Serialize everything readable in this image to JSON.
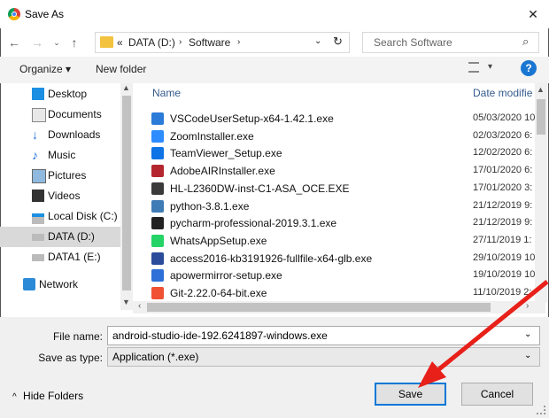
{
  "window": {
    "title": "Save As"
  },
  "nav": {
    "path": [
      "DATA (D:)",
      "Software"
    ],
    "overflow": "«",
    "search_placeholder": "Search Software"
  },
  "toolbar": {
    "organize": "Organize ▾",
    "new_folder": "New folder"
  },
  "sidebar": {
    "items": [
      {
        "label": "Desktop"
      },
      {
        "label": "Documents"
      },
      {
        "label": "Downloads"
      },
      {
        "label": "Music"
      },
      {
        "label": "Pictures"
      },
      {
        "label": "Videos"
      },
      {
        "label": "Local Disk (C:)"
      },
      {
        "label": "DATA (D:)"
      },
      {
        "label": "DATA1 (E:)"
      },
      {
        "label": "Network"
      }
    ]
  },
  "list": {
    "col_name": "Name",
    "col_date": "Date modified",
    "files": [
      {
        "name": "VSCodeUserSetup-x64-1.42.1.exe",
        "date": "05/03/2020 10",
        "color": "#2b7bd9"
      },
      {
        "name": "ZoomInstaller.exe",
        "date": "02/03/2020 6:",
        "color": "#2d8cff"
      },
      {
        "name": "TeamViewer_Setup.exe",
        "date": "12/02/2020 6:",
        "color": "#0e73e4"
      },
      {
        "name": "AdobeAIRInstaller.exe",
        "date": "17/01/2020 6:",
        "color": "#b4262e"
      },
      {
        "name": "HL-L2360DW-inst-C1-ASA_OCE.EXE",
        "date": "17/01/2020 3:",
        "color": "#3a3a3a"
      },
      {
        "name": "python-3.8.1.exe",
        "date": "21/12/2019 9:",
        "color": "#3f7cb5"
      },
      {
        "name": "pycharm-professional-2019.3.1.exe",
        "date": "21/12/2019 9:",
        "color": "#222222"
      },
      {
        "name": "WhatsAppSetup.exe",
        "date": "27/11/2019 1:",
        "color": "#25d366"
      },
      {
        "name": "access2016-kb3191926-fullfile-x64-glb.exe",
        "date": "29/10/2019 10",
        "color": "#2b4c9a"
      },
      {
        "name": "apowermirror-setup.exe",
        "date": "19/10/2019 10",
        "color": "#2e6fd8"
      },
      {
        "name": "Git-2.22.0-64-bit.exe",
        "date": "11/10/2019 2:",
        "color": "#f05133"
      }
    ]
  },
  "form": {
    "file_name_label": "File name:",
    "file_name_value": "android-studio-ide-192.6241897-windows.exe",
    "type_label": "Save as type:",
    "type_value": "Application (*.exe)"
  },
  "footer": {
    "hide_folders": "Hide Folders",
    "save": "Save",
    "cancel": "Cancel"
  },
  "colors": {
    "arrow": "#e8201a",
    "accent": "#0078d7"
  }
}
